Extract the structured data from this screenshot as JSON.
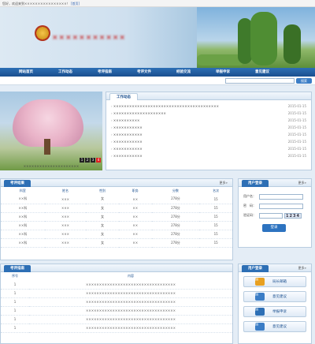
{
  "topbar": {
    "text": "您好，欢迎来到××××××××××××××××！",
    "link": "[首页]"
  },
  "nav": {
    "items": [
      "网站首页",
      "工作动态",
      "考评指南",
      "考评文件",
      "经验交流",
      "举报申诉",
      "意见建议"
    ]
  },
  "search": {
    "button": "搜索"
  },
  "photo": {
    "caption": "×××××××××××××××××××××",
    "pager": [
      "1",
      "2",
      "3",
      "4"
    ]
  },
  "news": {
    "title": "工作动态",
    "more": "更多»",
    "items": [
      {
        "t": "××××××××××××××××××××××××××××××××××××××××",
        "d": "2015-01-15"
      },
      {
        "t": "××××××××××××××××××××",
        "d": "2015-01-15"
      },
      {
        "t": "××××××××××",
        "d": "2015-01-15"
      },
      {
        "t": "×××××××××××",
        "d": "2015-01-15"
      },
      {
        "t": "×××××××××××",
        "d": "2015-01-15"
      },
      {
        "t": "×××××××××××",
        "d": "2015-01-15"
      },
      {
        "t": "×××××××××××",
        "d": "2015-01-15"
      },
      {
        "t": "×××××××××××",
        "d": "2015-01-15"
      }
    ]
  },
  "results": {
    "title": "考评结果",
    "more": "更多»",
    "headers": [
      "科室",
      "姓名",
      "性别",
      "职务",
      "分数",
      "名次"
    ],
    "rows": [
      [
        "××科",
        "×××",
        "女",
        "××",
        "278分",
        "15"
      ],
      [
        "××科",
        "×××",
        "女",
        "××",
        "278分",
        "15"
      ],
      [
        "××科",
        "×××",
        "女",
        "××",
        "278分",
        "15"
      ],
      [
        "××科",
        "×××",
        "女",
        "××",
        "278分",
        "15"
      ],
      [
        "××科",
        "×××",
        "女",
        "××",
        "278分",
        "15"
      ],
      [
        "××科",
        "×××",
        "女",
        "××",
        "278分",
        "15"
      ]
    ]
  },
  "login": {
    "title": "用户登录",
    "more": "更多»",
    "user_label": "用户名：",
    "pass_label": "密　码：",
    "code_label": "验证码：",
    "captcha": "1234",
    "button": "登录"
  },
  "notice": {
    "title": "考评指南",
    "headers": [
      "序号",
      "内容"
    ],
    "rows": [
      [
        "1",
        "××××××××××××××××××××××××××××××××××"
      ],
      [
        "1",
        "××××××××××××××××××××××××××××××××××"
      ],
      [
        "1",
        "××××××××××××××××××××××××××××××××××"
      ],
      [
        "1",
        "××××××××××××××××××××××××××××××××××"
      ],
      [
        "1",
        "××××××××××××××××××××××××××××××××××"
      ],
      [
        "1",
        "××××××××××××××××××××××××××××××××××"
      ]
    ]
  },
  "quick": {
    "title": "用户登录",
    "more": "更多»",
    "items": [
      {
        "label": "局长邮箱",
        "color": "#e8a020"
      },
      {
        "label": "意见建议",
        "color": "#3b7dc6"
      },
      {
        "label": "举报申诉",
        "color": "#2d6fb5"
      },
      {
        "label": "意见建议",
        "color": "#3b7dc6"
      }
    ]
  }
}
